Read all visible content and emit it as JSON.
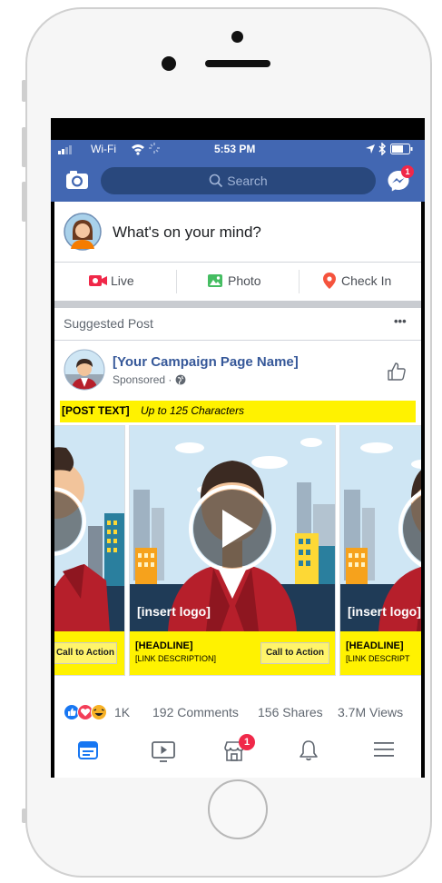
{
  "status": {
    "carrier": "Wi-Fi",
    "time": "5:53 PM"
  },
  "search": {
    "placeholder": "Search"
  },
  "messenger": {
    "badge": "1"
  },
  "composer": {
    "prompt": "What's on your mind?",
    "actions": [
      {
        "label": "Live",
        "icon": "live-video-icon",
        "color": "#f02849"
      },
      {
        "label": "Photo",
        "icon": "photo-icon",
        "color": "#45bd62"
      },
      {
        "label": "Check In",
        "icon": "location-pin-icon",
        "color": "#f5533d"
      }
    ]
  },
  "post": {
    "suggested_label": "Suggested Post",
    "more": "•••",
    "page_name": "[Your Campaign Page Name]",
    "sponsored": "Sponsored ·",
    "text_bold": "[POST TEXT]",
    "text_italic": "Up to 125 Characters",
    "cards": [
      {
        "logo": "",
        "headline": "",
        "description": "",
        "cta": "Call to Action"
      },
      {
        "logo": "[insert logo]",
        "headline": "[HEADLINE]",
        "description": "[LINK DESCRIPTION]",
        "cta": "Call to Action"
      },
      {
        "logo": "[insert logo]",
        "headline": "[HEADLINE]",
        "description": "[LINK DESCRIPT",
        "cta": ""
      }
    ],
    "stats": {
      "reactions_count": "1K",
      "comments": "192 Comments",
      "shares": "156 Shares",
      "views": "3.7M Views"
    }
  },
  "bottom_nav": {
    "notification_badge": "1",
    "active_color": "#1877f2"
  },
  "colors": {
    "facebook_blue": "#4267b2",
    "highlight_yellow": "#fff200",
    "link_blue": "#365899"
  }
}
